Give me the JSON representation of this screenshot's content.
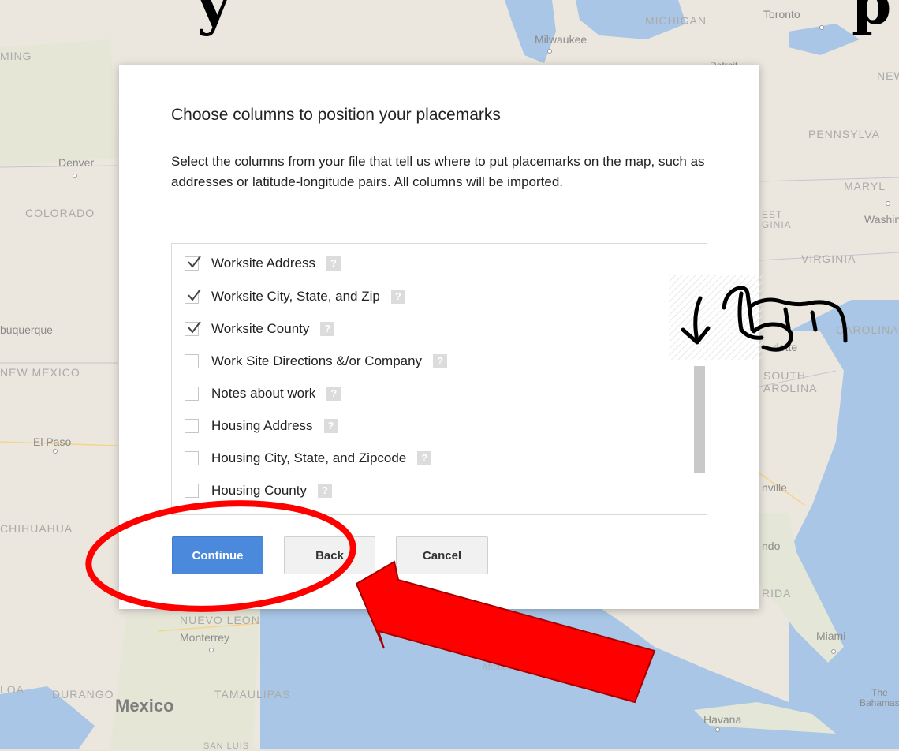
{
  "banner": {
    "left": "y",
    "right": "p"
  },
  "map_labels": {
    "michigan": "MICHIGAN",
    "toronto": "Toronto",
    "milwaukee": "Milwaukee",
    "detroit": "Detroit",
    "wyoming": "MING",
    "new_york": "NEW",
    "pennsylvania": "PENNSYLVA",
    "denver": "Denver",
    "colorado": "COLORADO",
    "maryland": "MARYL",
    "west_virginia": "EST\nGINIA",
    "washington": "Washing",
    "virginia": "VIRGINIA",
    "albuquerque": "buquerque",
    "carolina": "CAROLINA",
    "charlotte": "rlotte",
    "new_mexico": "NEW MEXICO",
    "south_carolina": "SOUTH\nAROLINA",
    "el_paso": "El Paso",
    "jacksonville": "nville",
    "chihuahua": "CHIHUAHUA",
    "orlando": "ndo",
    "florida": "RIDA",
    "nuevo_leon": "NUEVO LEON",
    "monterrey": "Monterrey",
    "miami": "Miami",
    "sinaloa": "LOA",
    "durango": "DURANGO",
    "gulf": "Gulf of\nMexico",
    "bahamas": "The\nBahamas",
    "tamaulipas": "TAMAULIPAS",
    "mexico": "Mexico",
    "havana": "Havana",
    "san_luis": "SAN LUIS"
  },
  "dialog": {
    "title": "Choose columns to position your placemarks",
    "description": "Select the columns from your file that tell us where to put placemarks on the map, such as addresses or latitude-longitude pairs. All columns will be imported.",
    "columns": [
      {
        "label": "Worksite Address",
        "checked": true
      },
      {
        "label": "Worksite City, State, and Zip",
        "checked": true
      },
      {
        "label": "Worksite County",
        "checked": true
      },
      {
        "label": "Work Site Directions &/or Company",
        "checked": false
      },
      {
        "label": "Notes about work",
        "checked": false
      },
      {
        "label": "Housing Address",
        "checked": false
      },
      {
        "label": "Housing City, State, and Zipcode",
        "checked": false
      },
      {
        "label": "Housing County",
        "checked": false
      }
    ],
    "help_glyph": "?",
    "buttons": {
      "continue": "Continue",
      "back": "Back",
      "cancel": "Cancel"
    }
  },
  "colors": {
    "primary_button": "#4a89dc",
    "annotation_red": "#ff0000"
  }
}
